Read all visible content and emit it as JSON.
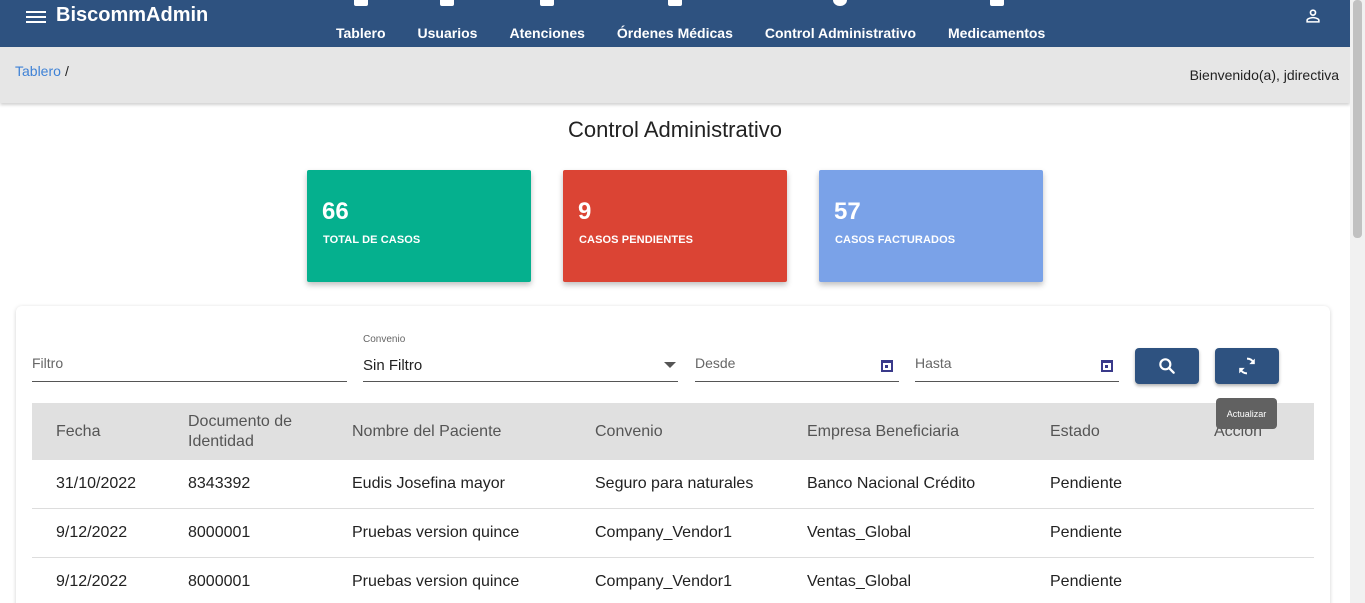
{
  "app": {
    "brand": "BiscommAdmin"
  },
  "nav": {
    "items": [
      {
        "label": "Tablero",
        "icon": "dashboard-icon"
      },
      {
        "label": "Usuarios",
        "icon": "users-icon"
      },
      {
        "label": "Atenciones",
        "icon": "clipboard-icon"
      },
      {
        "label": "Órdenes Médicas",
        "icon": "medical-order-icon"
      },
      {
        "label": "Control Administrativo",
        "icon": "admin-control-icon"
      },
      {
        "label": "Medicamentos",
        "icon": "medication-icon"
      }
    ]
  },
  "breadcrumb": {
    "link": "Tablero",
    "separator": "/"
  },
  "welcome": "Bienvenido(a), jdirectiva",
  "page_title": "Control Administrativo",
  "cards": [
    {
      "value": "66",
      "label": "TOTAL DE CASOS",
      "color": "#05b08e"
    },
    {
      "value": "9",
      "label": "CASOS PENDIENTES",
      "color": "#db4434"
    },
    {
      "value": "57",
      "label": "CASOS FACTURADOS",
      "color": "#7aa2e8"
    }
  ],
  "filters": {
    "filtro_placeholder": "Filtro",
    "convenio_label": "Convenio",
    "convenio_value": "Sin Filtro",
    "desde_placeholder": "Desde",
    "hasta_placeholder": "Hasta"
  },
  "buttons": {
    "refresh_tooltip": "Actualizar"
  },
  "table": {
    "headers": [
      "Fecha",
      "Documento de Identidad",
      "Nombre del Paciente",
      "Convenio",
      "Empresa Beneficiaria",
      "Estado",
      "Acción"
    ],
    "rows": [
      [
        "31/10/2022",
        "8343392",
        "Eudis Josefina mayor",
        "Seguro para naturales",
        "Banco Nacional Crédito",
        "Pendiente"
      ],
      [
        "9/12/2022",
        "8000001",
        "Pruebas version quince",
        "Company_Vendor1",
        "Ventas_Global",
        "Pendiente"
      ],
      [
        "9/12/2022",
        "8000001",
        "Pruebas version quince",
        "Company_Vendor1",
        "Ventas_Global",
        "Pendiente"
      ]
    ]
  },
  "colors": {
    "primary": "#2e5280",
    "link": "#3f82d6"
  }
}
